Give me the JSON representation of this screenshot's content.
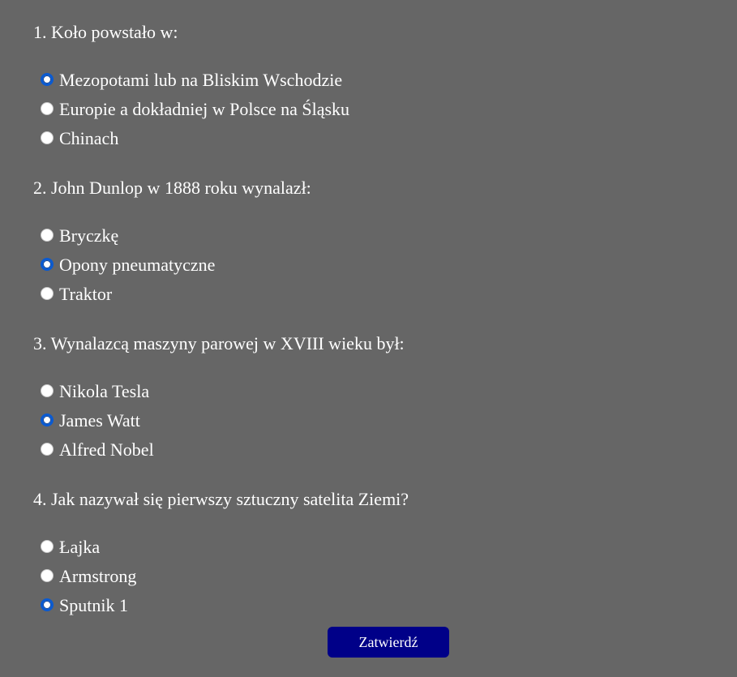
{
  "questions": [
    {
      "text": "1. Koło powstało w:",
      "options": [
        {
          "label": "Mezopotami lub na Bliskim Wschodzie",
          "checked": true
        },
        {
          "label": "Europie a dokładniej w Polsce na Śląsku",
          "checked": false
        },
        {
          "label": "Chinach",
          "checked": false
        }
      ]
    },
    {
      "text": "2. John Dunlop w 1888 roku wynalazł:",
      "options": [
        {
          "label": "Bryczkę",
          "checked": false
        },
        {
          "label": "Opony pneumatyczne",
          "checked": true
        },
        {
          "label": "Traktor",
          "checked": false
        }
      ]
    },
    {
      "text": "3. Wynalazcą maszyny parowej w XVIII wieku był:",
      "options": [
        {
          "label": "Nikola Tesla",
          "checked": false
        },
        {
          "label": "James Watt",
          "checked": true
        },
        {
          "label": "Alfred Nobel",
          "checked": false
        }
      ]
    },
    {
      "text": "4. Jak nazywał się pierwszy sztuczny satelita Ziemi?",
      "options": [
        {
          "label": "Łajka",
          "checked": false
        },
        {
          "label": "Armstrong",
          "checked": false
        },
        {
          "label": "Sputnik 1",
          "checked": true
        }
      ]
    }
  ],
  "submit_label": "Zatwierdź",
  "colors": {
    "background": "#666666",
    "text": "#ffffff",
    "button": "#000088",
    "radio_checked": "#0a5ad1"
  }
}
